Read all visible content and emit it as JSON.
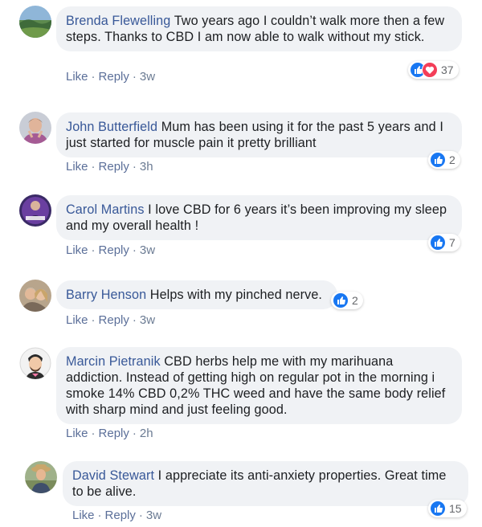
{
  "comments": [
    {
      "author": "Brenda Flewelling",
      "text": "Two years ago I couldn’t walk more then a few steps. Thanks to CBD I am now able to walk without my stick.",
      "like_label": "Like",
      "reply_label": "Reply",
      "time": "3w",
      "reaction_icons": [
        "like-icon",
        "love-icon"
      ],
      "reaction_count": "37"
    },
    {
      "author": "John Butterfield",
      "text": "Mum has been using it for the past 5 years and I just started for muscle pain it pretty brilliant",
      "like_label": "Like",
      "reply_label": "Reply",
      "time": "3h",
      "reaction_icons": [
        "like-icon"
      ],
      "reaction_count": "2"
    },
    {
      "author": "Carol Martins",
      "text": "I love CBD for 6 years it’s been improving my sleep and my overall health !",
      "like_label": "Like",
      "reply_label": "Reply",
      "time": "3w",
      "reaction_icons": [
        "like-icon"
      ],
      "reaction_count": "7"
    },
    {
      "author": "Barry Henson",
      "text": "Helps with my pinched nerve.",
      "like_label": "Like",
      "reply_label": "Reply",
      "time": "3w",
      "reaction_icons": [
        "like-icon"
      ],
      "reaction_count": "2"
    },
    {
      "author": "Marcin Pietranik",
      "text": "CBD herbs help me with my marihuana addiction. Instead of getting high on regular pot in the morning i smoke 14% CBD 0,2% THC weed and have the same body relief with sharp mind and just feeling good.",
      "like_label": "Like",
      "reply_label": "Reply",
      "time": "2h",
      "reaction_icons": [],
      "reaction_count": ""
    },
    {
      "author": "David Stewart",
      "text": "I appreciate its anti-anxiety properties. Great time to be alive.",
      "like_label": "Like",
      "reply_label": "Reply",
      "time": "3w",
      "reaction_icons": [
        "like-icon"
      ],
      "reaction_count": "15"
    }
  ],
  "colors": {
    "author_link": "#385898",
    "bubble_bg": "#f0f2f5",
    "like_blue": "#1877f2",
    "love_red": "#f33e58",
    "meta_text": "#6b7b93"
  }
}
